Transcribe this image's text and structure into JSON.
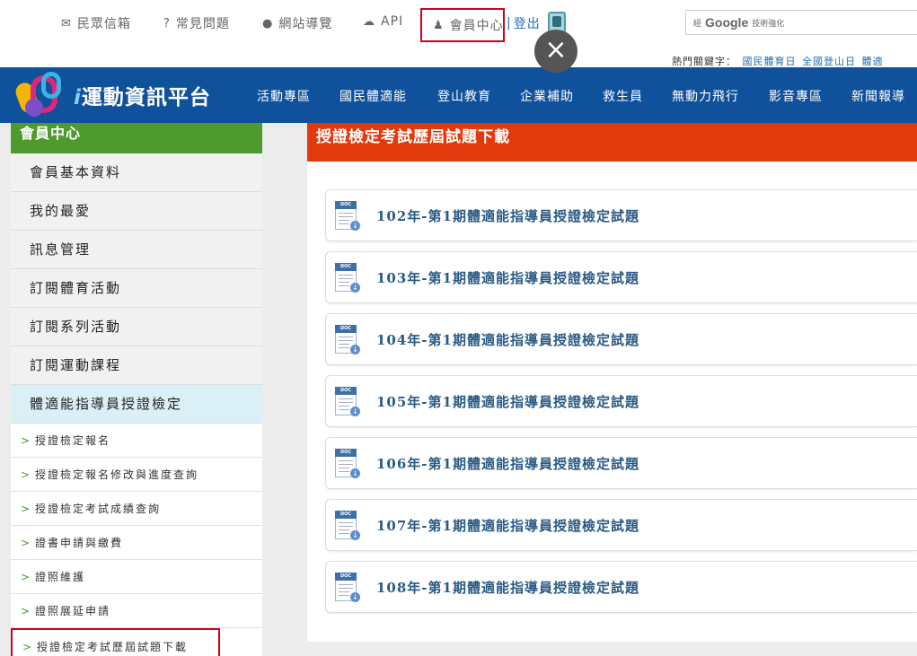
{
  "topbar": {
    "links": [
      {
        "icon": "mail-icon",
        "glyph": "✉",
        "label": "民眾信箱"
      },
      {
        "icon": "question-icon",
        "glyph": "?",
        "label": "常見問題"
      },
      {
        "icon": "globe-icon",
        "glyph": "●",
        "label": "網站導覽"
      },
      {
        "icon": "cloud-icon",
        "glyph": "☁",
        "label": "API"
      }
    ],
    "member": {
      "icon_glyph": "♟",
      "label": "會員中心"
    },
    "logout": {
      "sep": "|",
      "label": "登出"
    },
    "close_glyph": "×",
    "search": {
      "prefix": "經",
      "brand": "Google",
      "suffix": "技術強化"
    },
    "hot_keywords": {
      "label": "熱門關鍵字：",
      "items": [
        "國民體育日",
        "全國登山日",
        "體適"
      ]
    }
  },
  "navbar": {
    "logo_i": "i",
    "logo_text": "運動資訊平台",
    "items": [
      "活動專區",
      "國民體適能",
      "登山教育",
      "企業補助",
      "救生員",
      "無動力飛行",
      "影音專區",
      "新聞報導"
    ]
  },
  "sidebar": {
    "title": "會員中心",
    "items": [
      "會員基本資料",
      "我的最愛",
      "訊息管理",
      "訂閱體育活動",
      "訂閱系列活動",
      "訂閱運動課程",
      "體適能指導員授證檢定"
    ],
    "chevron": ">",
    "sub_items": [
      "授證檢定報名",
      "授證檢定報名修改與進度查詢",
      "授證檢定考試成績查詢",
      "證書申請與繳費",
      "證照維護",
      "證照展延申請",
      "授證檢定考試歷屆試題下載"
    ]
  },
  "main": {
    "title": "授證檢定考試歷屆試題下載",
    "doc_tag": "DOC",
    "download_glyph": "↓",
    "downloads": [
      "102年-第1期體適能指導員授證檢定試題",
      "103年-第1期體適能指導員授證檢定試題",
      "104年-第1期體適能指導員授證檢定試題",
      "105年-第1期體適能指導員授證檢定試題",
      "106年-第1期體適能指導員授證檢定試題",
      "107年-第1期體適能指導員授證檢定試題",
      "108年-第1期體適能指導員授證檢定試題"
    ]
  },
  "colors": {
    "nav_blue": "#10519b",
    "sidebar_green": "#4e9a2d",
    "title_orange": "#e13a0d",
    "highlight_red": "#d0021b",
    "active_item": "#dbeff6"
  }
}
